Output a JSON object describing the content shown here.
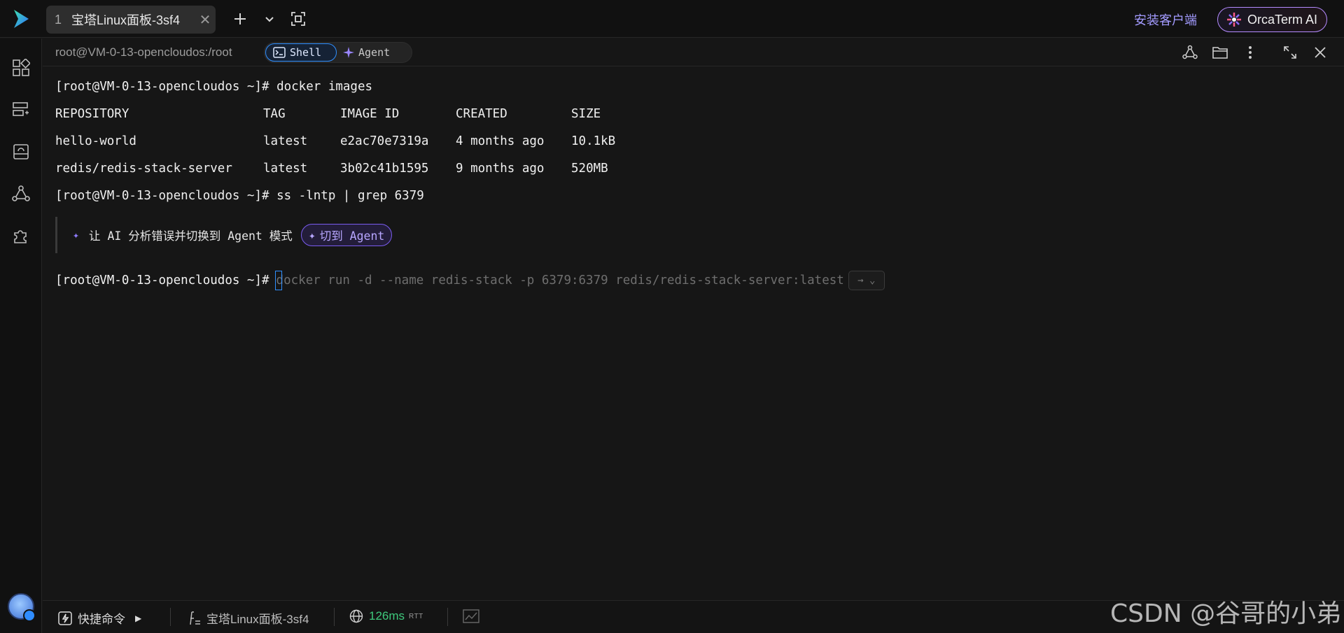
{
  "topbar": {
    "tab": {
      "number": "1",
      "title": "宝塔Linux面板-3sf4",
      "close": "✕"
    },
    "install_client": "安装客户端",
    "orca_button": "OrcaTerm AI"
  },
  "session": {
    "path": "root@VM-0-13-opencloudos:/root",
    "mode_shell": "Shell",
    "mode_agent": "Agent"
  },
  "terminal": {
    "line1": "[root@VM-0-13-opencloudos ~]# docker images",
    "headers": [
      "REPOSITORY",
      "TAG",
      "IMAGE ID",
      "CREATED",
      "SIZE"
    ],
    "rows": [
      [
        "hello-world",
        "latest",
        "e2ac70e7319a",
        "4 months ago",
        "10.1kB"
      ],
      [
        "redis/redis-stack-server",
        "latest",
        "3b02c41b1595",
        "9 months ago",
        "520MB"
      ]
    ],
    "line2": "[root@VM-0-13-opencloudos ~]# ss -lntp | grep 6379",
    "ai_hint": "让 AI 分析错误并切换到 Agent 模式",
    "switch_button": "切到 Agent",
    "prompt": "[root@VM-0-13-opencloudos ~]#",
    "suggestion": "docker run -d --name redis-stack -p 6379:6379 redis/redis-stack-server:latest",
    "accept_hint": "→ ⌄"
  },
  "statusbar": {
    "quick_commands": "快捷命令",
    "server_name": "宝塔Linux面板-3sf4",
    "latency": "126ms",
    "latency_unit": "RTT"
  },
  "watermark": "CSDN @谷哥的小弟",
  "colors": {
    "accent_blue": "#2f8fff",
    "accent_purple": "#a39bff",
    "latency_green": "#3ec97c",
    "background": "#161616"
  }
}
